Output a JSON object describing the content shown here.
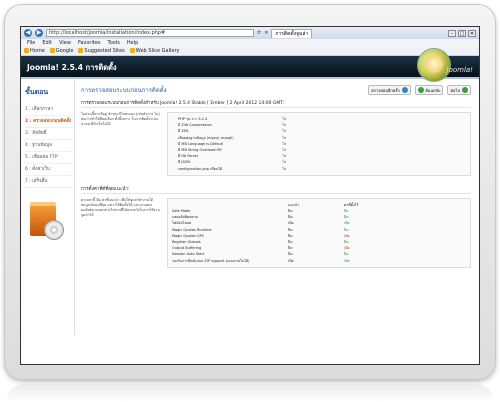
{
  "browser": {
    "url": "http://localhost/joomla/installation/index.php#",
    "tab_title": "การติดตั้งจูมล่า",
    "menu": [
      "File",
      "Edit",
      "View",
      "Favorites",
      "Tools",
      "Help"
    ],
    "favorites": [
      "Home",
      "Google",
      "Suggested Sites",
      "Web Slice Gallery"
    ]
  },
  "joomla": {
    "header_title": "Joomla! 2.5.4 การติดตั้ง",
    "logo_text": "Joomla!",
    "sidebar_title": "ขั้นตอน",
    "steps": [
      "1 : เลือกภาษา",
      "2 : ตรวจสอบก่อนติดตั้ง",
      "3 : ลิขสิทธิ์",
      "4 : ฐานข้อมูล",
      "5 : เชื่อมต่อ FTP",
      "6 : ตั้งค่าเว็บ",
      "7 : เสร็จสิ้น"
    ],
    "active_step": 1,
    "page_title": "การตรวจสอบระบบก่อนการติดตั้ง",
    "buttons": {
      "recheck": "ตรวจสอบอีกครั้ง",
      "prev": "ย้อนกลับ",
      "next": "ต่อไป"
    },
    "subtitle": "การตรวจสอบระบบก่อนการติดตั้งสำหรับ Joomla! 2.5.4 Stable [ Ember ] 2 April 2012 14:00 GMT:",
    "section1_desc": "ในส่วนนี้หากมีอยู่ ชำรุดแก้ไขตนเอง (เช่นตัวการ ไม่) ต่อการทำให้มีผลเลือก ทั้งนี้เพราะ ในการติดตั้งระบบอาจจะมีสำเร็จไม่ได้",
    "checks": [
      {
        "label": "PHP รุ่น >= 5.2.4",
        "value": "ใช่"
      },
      {
        "label": "มี Zlib Compression",
        "value": "ใช่"
      },
      {
        "label": "มี XML",
        "value": "ใช่"
      },
      {
        "label": "เชื่อมต่อฐานข้อมูล (mysql, mysqli)",
        "value": "ใช่"
      },
      {
        "label": "มี MB Language is Default",
        "value": "ใช่"
      },
      {
        "label": "มี MB String Overload Off",
        "value": "ใช่"
      },
      {
        "label": "มี INI Parser",
        "value": "ใช่"
      },
      {
        "label": "มี JSON",
        "value": "ใช่"
      },
      {
        "label": "configuration.php เขียนได้",
        "value": "ใช่"
      }
    ],
    "section2_title": "การตั้งค่าที่ดีที่สุดแนะนำ:",
    "section2_desc": "ค่าเหล่านี้ คือ ค่าที่แนะนำ เพื่อให้จูมล่าทำงานได้สมบูรณ์แบบที่สุด แต่ว่าให้ติดตั้งได้ และจะแสดงผลลัพธ์อาจแตกต่างไปจากที่ได้คาดหวังในการใช้งานจูมล่าได้",
    "settings_header": {
      "label": "",
      "recommended": "แนะนำ",
      "actual": "ค่าที่ตั้งไว้"
    },
    "settings": [
      {
        "label": "Safe Mode",
        "recommended": "ปิด",
        "actual": "ปิด",
        "status": "ok"
      },
      {
        "label": "แสดงข้อผิดพลาด",
        "recommended": "ปิด",
        "actual": "ปิด",
        "status": "ok"
      },
      {
        "label": "ไฟล์อัปโหลด",
        "recommended": "เปิด",
        "actual": "เปิด",
        "status": "ok"
      },
      {
        "label": "Magic Quotes Runtime",
        "recommended": "ปิด",
        "actual": "ปิด",
        "status": "ok"
      },
      {
        "label": "Magic Quotes GPC",
        "recommended": "ปิด",
        "actual": "เปิด",
        "status": "bad"
      },
      {
        "label": "Register Globals",
        "recommended": "ปิด",
        "actual": "ปิด",
        "status": "ok"
      },
      {
        "label": "Output Buffering",
        "recommended": "ปิด",
        "actual": "เปิด",
        "status": "bad"
      },
      {
        "label": "Session Auto Start",
        "recommended": "ปิด",
        "actual": "ปิด",
        "status": "ok"
      },
      {
        "label": "รองรับการบีบอัดแบบ ZIP support (แบบภายในได้)",
        "recommended": "เปิด",
        "actual": "เปิด",
        "status": "ok"
      }
    ]
  },
  "colors": {
    "accent": "#2b65a8",
    "active_step": "#d25a10",
    "ok": "#2c8a2c",
    "bad": "#c02020"
  }
}
